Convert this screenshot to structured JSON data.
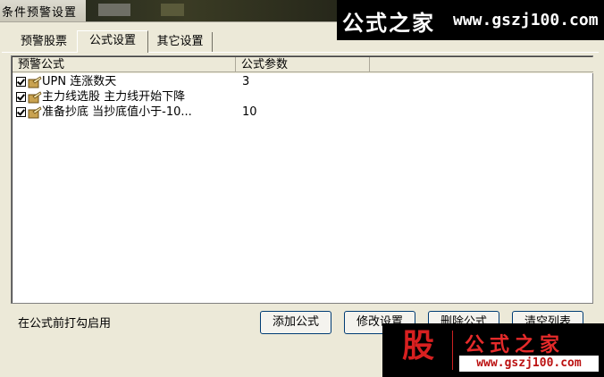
{
  "window": {
    "title": "条件预警设置"
  },
  "watermark_top": {
    "text": "公式之家",
    "url": "www.gszj100.com"
  },
  "tabs": [
    {
      "label": "预警股票",
      "active": false
    },
    {
      "label": "公式设置",
      "active": true
    },
    {
      "label": "其它设置",
      "active": false
    }
  ],
  "list": {
    "columns": [
      "预警公式",
      "公式参数",
      ""
    ],
    "rows": [
      {
        "checked": true,
        "name": "UPN 连涨数天",
        "param": "3"
      },
      {
        "checked": true,
        "name": "主力线选股 主力线开始下降",
        "param": ""
      },
      {
        "checked": true,
        "name": "准备抄底 当抄底值小于-10...",
        "param": "10"
      }
    ]
  },
  "hint": "在公式前打勾启用",
  "buttons": {
    "add": "添加公式",
    "modify": "修改设置",
    "delete": "删除公式",
    "clear": "清空列表"
  },
  "watermark_bottom": {
    "glyph": "股",
    "text": "公式之家",
    "url": "www.gszj100.com"
  },
  "colors": {
    "window_bg": "#ece9d8",
    "button_border": "#003c74",
    "watermark_red": "#e52a2a"
  }
}
